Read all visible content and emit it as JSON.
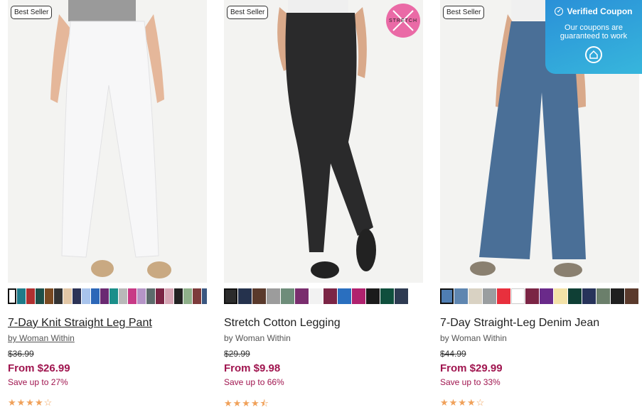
{
  "products": [
    {
      "badge": "Best Seller",
      "title": "7-Day Knit Straight Leg Pant",
      "brand": "by Woman Within",
      "original_price": "$36.99",
      "price": "From $26.99",
      "savings": "Save up to 27%",
      "rating": 4,
      "stars": "★★★★☆",
      "swatch_colors": [
        "#ffffff",
        "#1e7b8a",
        "#b03030",
        "#1d4f49",
        "#7a4a22",
        "#333333",
        "#e2c7a6",
        "#2c3356",
        "#a9c4ec",
        "#2c67b8",
        "#6a2a72",
        "#1b8f8a",
        "#b9b9b9",
        "#c83a86",
        "#b595c7",
        "#5c6b6b",
        "#7b2545",
        "#d6a6b5",
        "#222222",
        "#8fb08a",
        "#7d3b3b",
        "#3a5780"
      ],
      "pant_color": "#f7f7f8"
    },
    {
      "badge": "Best Seller",
      "stretch_label": "STRETCH",
      "title": "Stretch Cotton Legging",
      "brand": "by Woman Within",
      "original_price": "$29.99",
      "price": "From $9.98",
      "savings": "Save up to 66%",
      "rating": 4.5,
      "stars": "★★★★⯪",
      "swatch_colors": [
        "#2b2b2b",
        "#25324d",
        "#5a3a2c",
        "#9c9c9c",
        "#6e8d7a",
        "#7a2e6e",
        "#f2f2f2",
        "#7b2545",
        "#2a6fbf",
        "#b0226e",
        "#1b1b1b",
        "#0f4f3d",
        "#2e3b52"
      ],
      "pant_color": "#2a2a2b"
    },
    {
      "badge": "Best Seller",
      "title": "7-Day Straight-Leg Denim Jean",
      "brand": "by Woman Within",
      "original_price": "$44.99",
      "price": "From $29.99",
      "savings": "Save up to 33%",
      "rating": 4,
      "stars": "★★★★☆",
      "swatch_colors": [
        "#4f7eb3",
        "#5f86b0",
        "#d9d2c3",
        "#9a9ea0",
        "#e8303d",
        "#ffffff",
        "#7b2545",
        "#6a2a8a",
        "#f3e2a8",
        "#0f3f35",
        "#27335a",
        "#6b7f6b",
        "#1f1f1f",
        "#5a3a2c",
        "#253a6a"
      ],
      "pant_color": "#4a6f97"
    }
  ],
  "coupon": {
    "title": "Verified Coupon",
    "message": "Our coupons are guaranteed to work"
  }
}
